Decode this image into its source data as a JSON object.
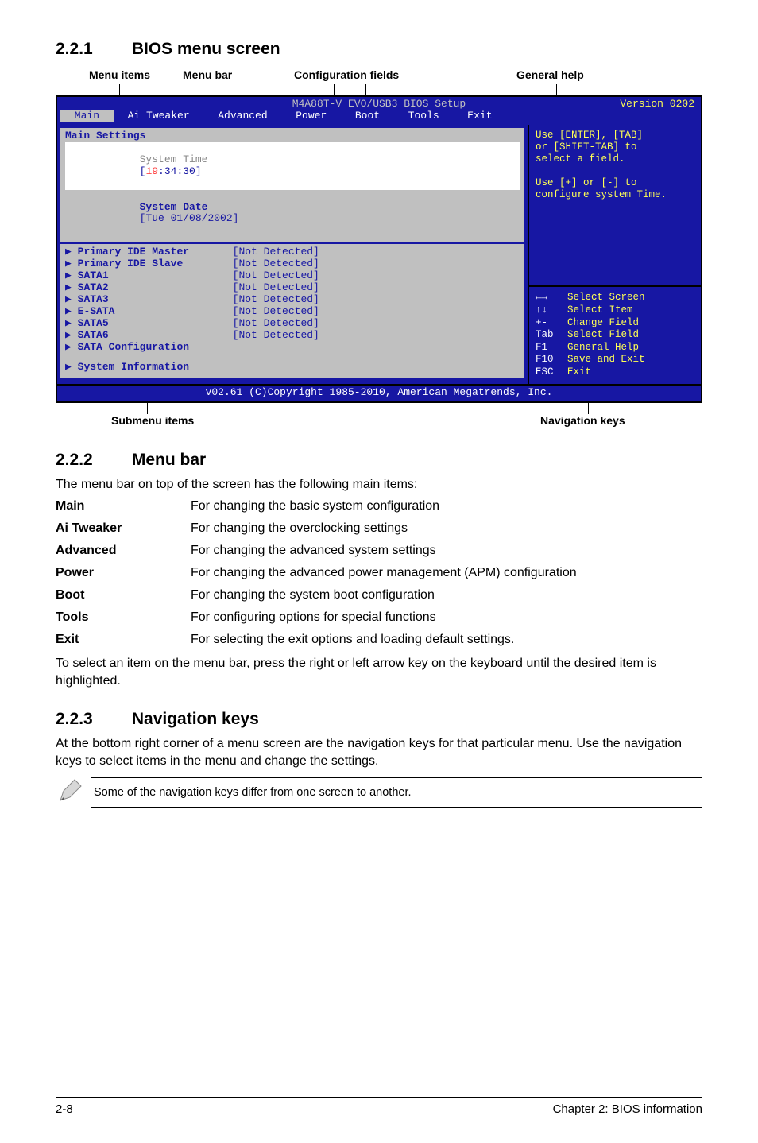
{
  "sections": {
    "s1_num": "2.2.1",
    "s1_title": "BIOS menu screen",
    "s2_num": "2.2.2",
    "s2_title": "Menu bar",
    "s3_num": "2.2.3",
    "s3_title": "Navigation keys"
  },
  "callouts": {
    "menu_items": "Menu items",
    "menu_bar": "Menu bar",
    "config_fields": "Configuration fields",
    "general_help": "General help",
    "submenu_items": "Submenu items",
    "nav_keys": "Navigation keys"
  },
  "bios": {
    "title": "M4A88T-V EVO/USB3 BIOS Setup",
    "version": "Version 0202",
    "tabs": [
      "Main",
      "Ai Tweaker",
      "Advanced",
      "Power",
      "Boot",
      "Tools",
      "Exit"
    ],
    "active_tab": 0,
    "left": {
      "heading": "Main Settings",
      "rowA_label": "System Time",
      "rowA_value_pre": "[",
      "rowA_value_hl": "19",
      "rowA_value_post": ":34:30]",
      "rowB_label": "System Date",
      "rowB_value": "[Tue 01/08/2002]",
      "items": [
        {
          "label": "Primary IDE Master",
          "value": "[Not Detected]"
        },
        {
          "label": "Primary IDE Slave",
          "value": "[Not Detected]"
        },
        {
          "label": "SATA1",
          "value": "[Not Detected]"
        },
        {
          "label": "SATA2",
          "value": "[Not Detected]"
        },
        {
          "label": "SATA3",
          "value": "[Not Detected]"
        },
        {
          "label": "E-SATA",
          "value": "[Not Detected]"
        },
        {
          "label": "SATA5",
          "value": "[Not Detected]"
        },
        {
          "label": "SATA6",
          "value": "[Not Detected]"
        }
      ],
      "sub1": "SATA Configuration",
      "sub2": "System Information"
    },
    "help_top": "Use [ENTER], [TAB]\nor [SHIFT-TAB] to\nselect a field.\n\nUse [+] or [-] to\nconfigure system Time.",
    "help_bot": [
      {
        "k": "←→",
        "v": "Select Screen"
      },
      {
        "k": "↑↓",
        "v": "Select Item"
      },
      {
        "k": "+-",
        "v": "Change Field"
      },
      {
        "k": "Tab",
        "v": "Select Field"
      },
      {
        "k": "F1",
        "v": "General Help"
      },
      {
        "k": "F10",
        "v": "Save and Exit"
      },
      {
        "k": "ESC",
        "v": "Exit"
      }
    ],
    "footer": "v02.61 (C)Copyright 1985-2010, American Megatrends, Inc."
  },
  "menubar_intro": "The menu bar on top of the screen has the following main items:",
  "menubar_items": [
    {
      "k": "Main",
      "v": "For changing the basic system configuration"
    },
    {
      "k": "Ai Tweaker",
      "v": "For changing the overclocking settings"
    },
    {
      "k": "Advanced",
      "v": "For changing the advanced system settings"
    },
    {
      "k": "Power",
      "v": "For changing the advanced power management (APM) configuration"
    },
    {
      "k": "Boot",
      "v": "For changing the system boot configuration"
    },
    {
      "k": "Tools",
      "v": "For configuring options for special functions"
    },
    {
      "k": "Exit",
      "v": "For selecting the exit options and loading default settings."
    }
  ],
  "menubar_note": "To select an item on the menu bar, press the right or left arrow key on the keyboard until the desired item is highlighted.",
  "navkeys_p": "At the bottom right corner of a menu screen are the navigation keys for that particular menu. Use the navigation keys to select items in the menu and change the settings.",
  "note_text": "Some of the navigation keys differ from one screen to another.",
  "footer": {
    "left": "2-8",
    "right": "Chapter 2: BIOS information"
  }
}
